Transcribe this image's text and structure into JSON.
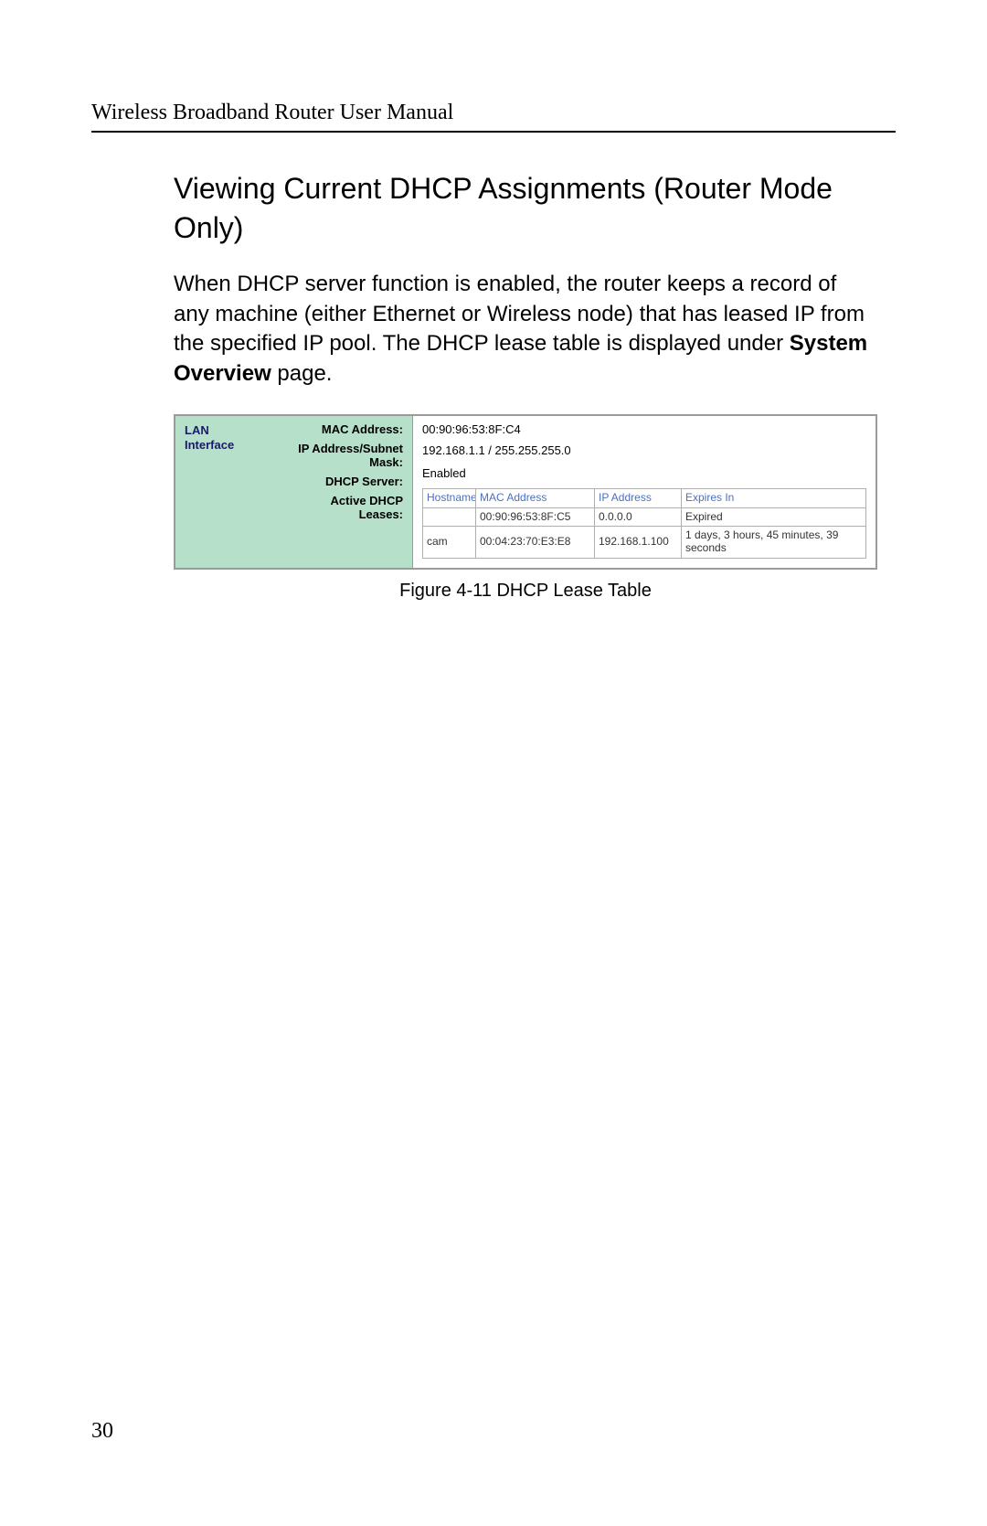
{
  "header": {
    "running_title": "Wireless Broadband Router User Manual"
  },
  "section": {
    "title": "Viewing Current DHCP Assignments (Router Mode Only)",
    "para_prefix": "When DHCP server function is enabled, the router keeps a record of any machine (either Ethernet or Wireless node) that has leased IP from the specified IP pool. The DHCP lease table is displayed under ",
    "para_bold": "System Overview",
    "para_suffix": " page."
  },
  "panel": {
    "group_name": "LAN Interface",
    "labels": {
      "mac": "MAC Address:",
      "ip_subnet_l1": "IP Address/Subnet",
      "ip_subnet_l2": "Mask:",
      "dhcp_server": "DHCP Server:",
      "active_l1": "Active DHCP",
      "active_l2": "Leases:"
    },
    "values": {
      "mac": "00:90:96:53:8F:C4",
      "ip_subnet": "192.168.1.1 / 255.255.255.0",
      "dhcp_server": "Enabled"
    },
    "lease_table": {
      "headers": {
        "hostname": "Hostname",
        "mac": "MAC Address",
        "ip": "IP Address",
        "expires": "Expires In"
      },
      "rows": [
        {
          "hostname": "",
          "mac": "00:90:96:53:8F:C5",
          "ip": "0.0.0.0",
          "expires": "Expired"
        },
        {
          "hostname": "cam",
          "mac": "00:04:23:70:E3:E8",
          "ip": "192.168.1.100",
          "expires": "1 days, 3 hours, 45 minutes, 39 seconds"
        }
      ]
    }
  },
  "figure_caption": "Figure 4-11  DHCP Lease Table",
  "page_number": "30"
}
